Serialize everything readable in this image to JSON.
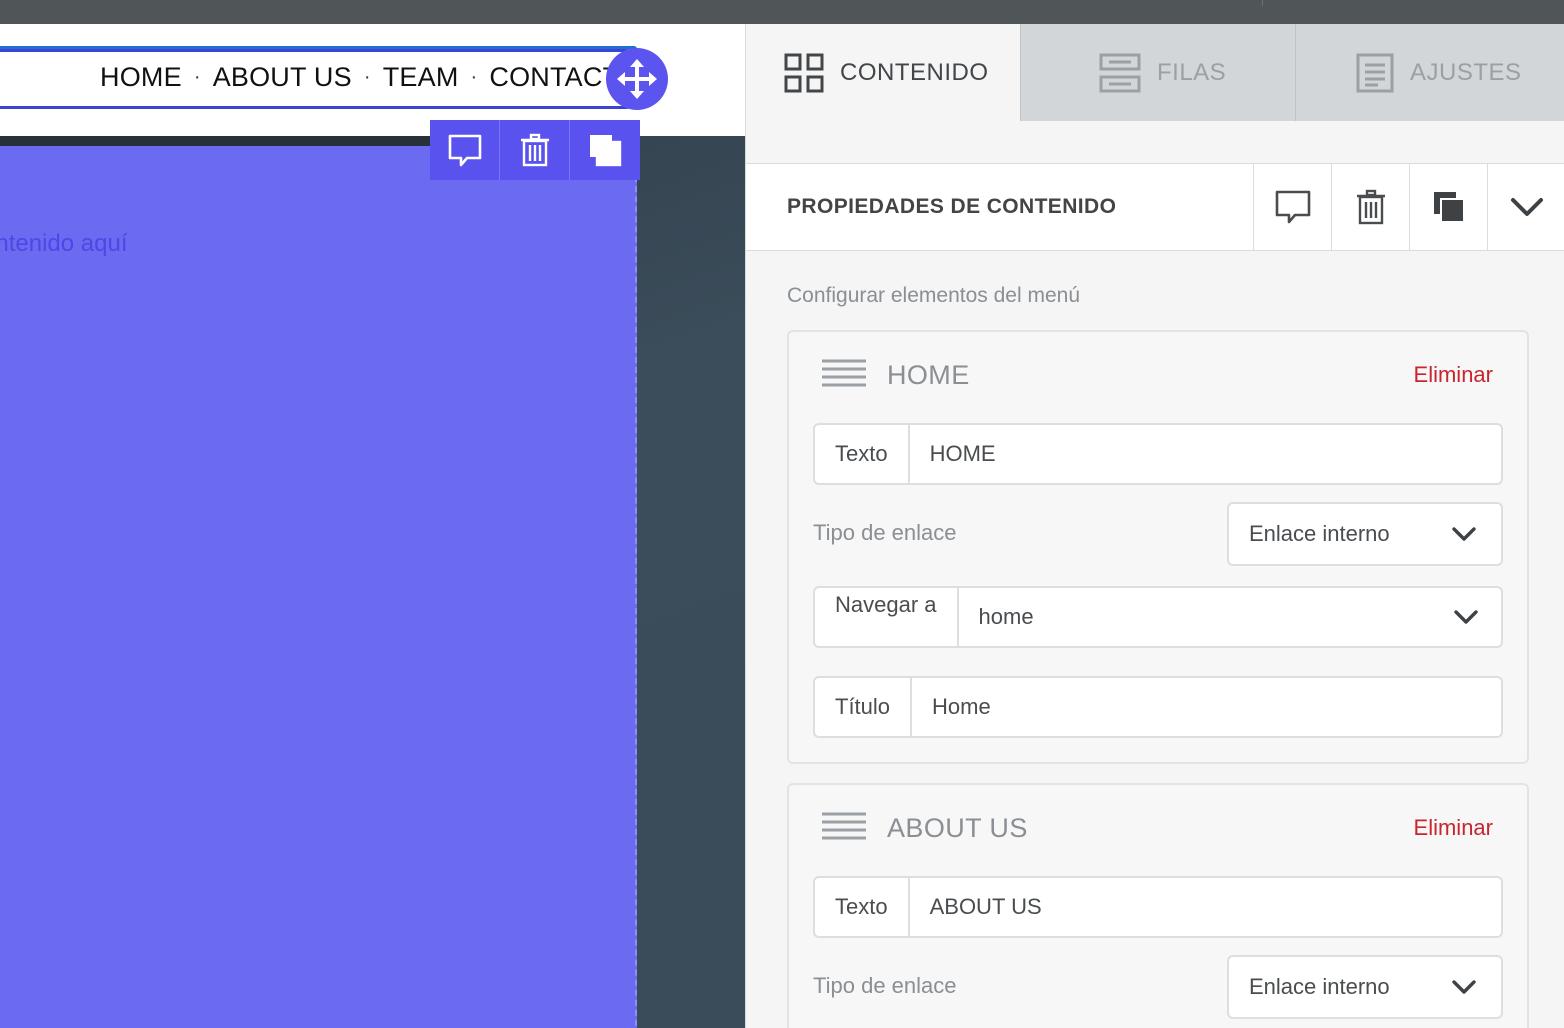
{
  "canvas": {
    "menu_items": [
      "HOME",
      "ABOUT US",
      "TEAM",
      "CONTACT"
    ],
    "menu_separator": "·",
    "placeholder_text": "Arrastra contenido aquí",
    "accent_color": "#5b54ee",
    "block_color": "#6b6bf1",
    "icons": {
      "move": "move-arrows-icon",
      "comment": "comment-icon",
      "delete": "trash-icon",
      "duplicate": "duplicate-icon"
    }
  },
  "panel": {
    "tabs": [
      {
        "label": "CONTENIDO",
        "icon": "grid-icon",
        "active": true
      },
      {
        "label": "FILAS",
        "icon": "rows-icon",
        "active": false
      },
      {
        "label": "AJUSTES",
        "icon": "settings-doc-icon",
        "active": false
      }
    ],
    "properties_title": "PROPIEDADES DE CONTENIDO",
    "config_label": "Configurar elementos del menú",
    "items": [
      {
        "title": "HOME",
        "remove_label": "Eliminar",
        "text_label": "Texto",
        "text_value": "HOME",
        "link_type_label": "Tipo de enlace",
        "link_type_value": "Enlace interno",
        "navigate_label": "Navegar a",
        "navigate_value": "home",
        "title_label": "Título",
        "title_value": "Home"
      },
      {
        "title": "ABOUT US",
        "remove_label": "Eliminar",
        "text_label": "Texto",
        "text_value": "ABOUT US",
        "link_type_label": "Tipo de enlace",
        "link_type_value": "Enlace interno"
      }
    ],
    "remove_color": "#c8252c"
  }
}
